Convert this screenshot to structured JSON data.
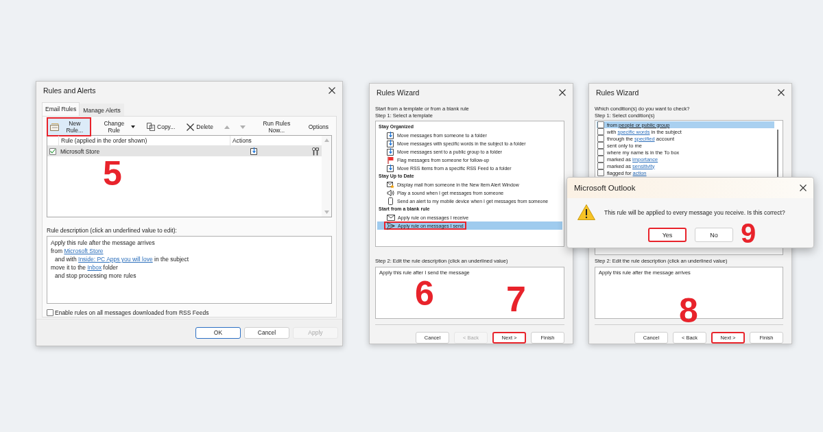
{
  "rules_dialog": {
    "title": "Rules and Alerts",
    "tabs": [
      {
        "label": "Email Rules",
        "selected": true
      },
      {
        "label": "Manage Alerts",
        "selected": false
      }
    ],
    "toolbar": [
      {
        "kind": "new",
        "label": "New Rule...",
        "highlighted": true
      },
      {
        "kind": "change",
        "label": "Change Rule",
        "highlighted": false
      },
      {
        "kind": "copy",
        "label": "Copy...",
        "highlighted": false
      },
      {
        "kind": "delete",
        "label": "Delete",
        "highlighted": false
      },
      {
        "kind": "up",
        "highlighted": false
      },
      {
        "kind": "down",
        "highlighted": false
      },
      {
        "kind": "text",
        "label": "Run Rules Now...",
        "highlighted": false
      },
      {
        "kind": "text",
        "label": "Options",
        "highlighted": false
      }
    ],
    "columns": [
      "Rule (applied in the order shown)",
      "Actions"
    ],
    "rules": [
      {
        "name": "Microsoft Store",
        "checked": true,
        "selected": true
      }
    ],
    "description_label": "Rule description (click an underlined value to edit):",
    "description": [
      {
        "indented": false,
        "parts": [
          {
            "text": "Apply this rule after the message arrives",
            "link": false
          }
        ]
      },
      {
        "indented": false,
        "parts": [
          {
            "text": "from ",
            "link": false
          },
          {
            "text": "Microsoft Store",
            "link": true
          }
        ]
      },
      {
        "indented": true,
        "parts": [
          {
            "text": "and with ",
            "link": false
          },
          {
            "text": "Inside: PC Apps you will love",
            "link": true
          },
          {
            "text": " in the subject",
            "link": false
          }
        ]
      },
      {
        "indented": false,
        "parts": [
          {
            "text": "move it to the ",
            "link": false
          },
          {
            "text": "Inbox",
            "link": true
          },
          {
            "text": " folder",
            "link": false
          }
        ]
      },
      {
        "indented": true,
        "parts": [
          {
            "text": "and stop processing more rules",
            "link": false
          }
        ]
      }
    ],
    "rss_option": {
      "label": "Enable rules on all messages downloaded from RSS Feeds",
      "checked": false
    },
    "buttons": [
      {
        "label": "OK",
        "default": true,
        "disabled": false
      },
      {
        "label": "Cancel",
        "default": false,
        "disabled": false
      },
      {
        "label": "Apply",
        "default": false,
        "disabled": true
      }
    ],
    "step_markers": [
      "5"
    ]
  },
  "template_wizard": {
    "title": "Rules Wizard",
    "intro": "Start from a template or from a blank rule",
    "step1_label": "Step 1: Select a template",
    "groups": [
      {
        "heading": "Stay Organized",
        "items": [
          {
            "kind": "move",
            "label": "Move messages from someone to a folder",
            "selected": false,
            "highlighted": false
          },
          {
            "kind": "move",
            "label": "Move messages with specific words in the subject to a folder",
            "selected": false,
            "highlighted": false
          },
          {
            "kind": "move",
            "label": "Move messages sent to a public group to a folder",
            "selected": false,
            "highlighted": false
          },
          {
            "kind": "flag",
            "label": "Flag messages from someone for follow-up",
            "selected": false,
            "highlighted": false
          },
          {
            "kind": "move",
            "label": "Move RSS items from a specific RSS Feed to a folder",
            "selected": false,
            "highlighted": false
          }
        ]
      },
      {
        "heading": "Stay Up to Date",
        "items": [
          {
            "kind": "alert",
            "label": "Display mail from someone in the New Item Alert Window",
            "selected": false,
            "highlighted": false
          },
          {
            "kind": "sound",
            "label": "Play a sound when I get messages from someone",
            "selected": false,
            "highlighted": false
          },
          {
            "kind": "mobile",
            "label": "Send an alert to my mobile device when I get messages from someone",
            "selected": false,
            "highlighted": false
          }
        ]
      },
      {
        "heading": "Start from a blank rule",
        "items": [
          {
            "kind": "receive",
            "label": "Apply rule on messages I receive",
            "selected": false,
            "highlighted": false
          },
          {
            "kind": "send",
            "label": "Apply rule on messages I send",
            "selected": true,
            "highlighted": true
          }
        ]
      }
    ],
    "step2_label": "Step 2: Edit the rule description (click an underlined value)",
    "description": "Apply this rule after I send the message",
    "buttons": [
      {
        "label": "Cancel",
        "disabled": false,
        "highlighted": false
      },
      {
        "label": "< Back",
        "disabled": true,
        "highlighted": false
      },
      {
        "label": "Next >",
        "disabled": false,
        "highlighted": true
      },
      {
        "label": "Finish",
        "disabled": false,
        "highlighted": false
      }
    ],
    "step_markers": [
      "6",
      "7"
    ]
  },
  "condition_wizard": {
    "title": "Rules Wizard",
    "intro": "Which condition(s) do you want to check?",
    "step1_label": "Step 1: Select condition(s)",
    "conditions": [
      {
        "checked": false,
        "selected": true,
        "parts": [
          {
            "text": "from ",
            "link": false
          },
          {
            "text": "people or public group",
            "link": true
          }
        ]
      },
      {
        "checked": false,
        "selected": false,
        "parts": [
          {
            "text": "with ",
            "link": false
          },
          {
            "text": "specific words",
            "link": true
          },
          {
            "text": " in the subject",
            "link": false
          }
        ]
      },
      {
        "checked": false,
        "selected": false,
        "parts": [
          {
            "text": "through the ",
            "link": false
          },
          {
            "text": "specified",
            "link": true
          },
          {
            "text": " account",
            "link": false
          }
        ]
      },
      {
        "checked": false,
        "selected": false,
        "parts": [
          {
            "text": "sent only to me",
            "link": false
          }
        ]
      },
      {
        "checked": false,
        "selected": false,
        "parts": [
          {
            "text": "where my name is in the To box",
            "link": false
          }
        ]
      },
      {
        "checked": false,
        "selected": false,
        "parts": [
          {
            "text": "marked as ",
            "link": false
          },
          {
            "text": "importance",
            "link": true
          }
        ]
      },
      {
        "checked": false,
        "selected": false,
        "parts": [
          {
            "text": "marked as ",
            "link": false
          },
          {
            "text": "sensitivity",
            "link": true
          }
        ]
      },
      {
        "checked": false,
        "selected": false,
        "parts": [
          {
            "text": "flagged for ",
            "link": false
          },
          {
            "text": "action",
            "link": true
          }
        ]
      }
    ],
    "step2_label": "Step 2: Edit the rule description (click an underlined value)",
    "description": "Apply this rule after the message arrives",
    "buttons": [
      {
        "label": "Cancel",
        "disabled": false,
        "highlighted": false
      },
      {
        "label": "< Back",
        "disabled": false,
        "highlighted": false
      },
      {
        "label": "Next >",
        "disabled": false,
        "highlighted": true
      },
      {
        "label": "Finish",
        "disabled": false,
        "highlighted": false
      }
    ],
    "step_markers": [
      "8"
    ]
  },
  "confirm_dialog": {
    "title": "Microsoft Outlook",
    "message": "This rule will be applied to every message you receive. Is this correct?",
    "buttons": [
      {
        "label": "Yes",
        "default": true,
        "highlighted": true
      },
      {
        "label": "No",
        "default": false,
        "highlighted": false
      }
    ],
    "step_markers": [
      "9"
    ]
  }
}
